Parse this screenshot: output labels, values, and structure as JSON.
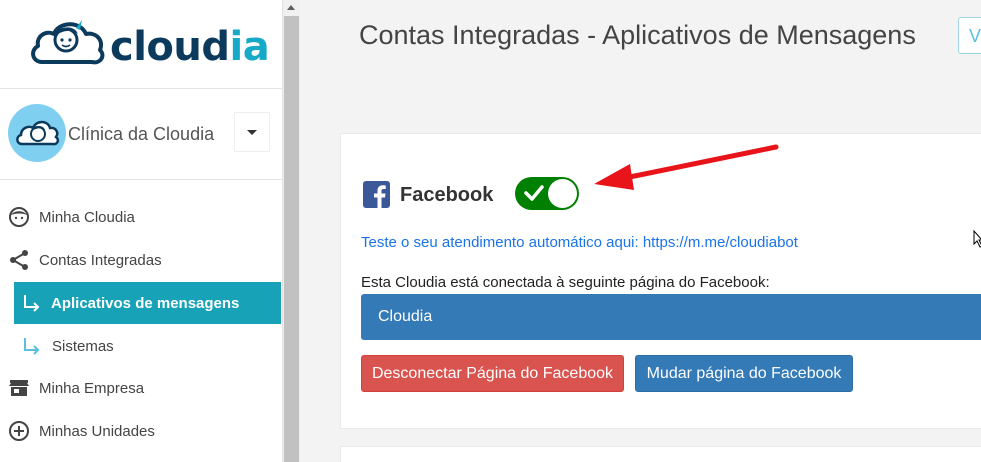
{
  "brand": {
    "name_part1": "cloud",
    "name_part2": "ia"
  },
  "clinic": {
    "name": "Clínica da Cloudia"
  },
  "nav": {
    "items": [
      {
        "label": "Minha Cloudia",
        "icon": "face-icon"
      },
      {
        "label": "Contas Integradas",
        "icon": "share-icon"
      },
      {
        "label": "Aplicativos de mensagens",
        "icon": "subitem-arrow-icon",
        "active": true
      },
      {
        "label": "Sistemas",
        "icon": "subitem-arrow-icon"
      },
      {
        "label": "Minha Empresa",
        "icon": "store-icon"
      },
      {
        "label": "Minhas Unidades",
        "icon": "add-circle-icon"
      }
    ]
  },
  "header": {
    "title": "Contas Integradas - Aplicativos de Mensagens",
    "top_button": "V"
  },
  "facebook": {
    "label": "Facebook",
    "toggle_on": true,
    "test_link": "Teste o seu atendimento automático aqui: https://m.me/cloudiabot",
    "connected_text": "Esta Cloudia está conectada à seguinte página do Facebook:",
    "selected_page": "Cloudia",
    "disconnect_label": "Desconectar Página do Facebook",
    "change_label": "Mudar página do Facebook"
  },
  "colors": {
    "accent": "#17a2b8",
    "primary": "#337ab7",
    "danger": "#d9534f",
    "toggle_on": "#008000",
    "annotation_arrow": "#e8141a"
  }
}
